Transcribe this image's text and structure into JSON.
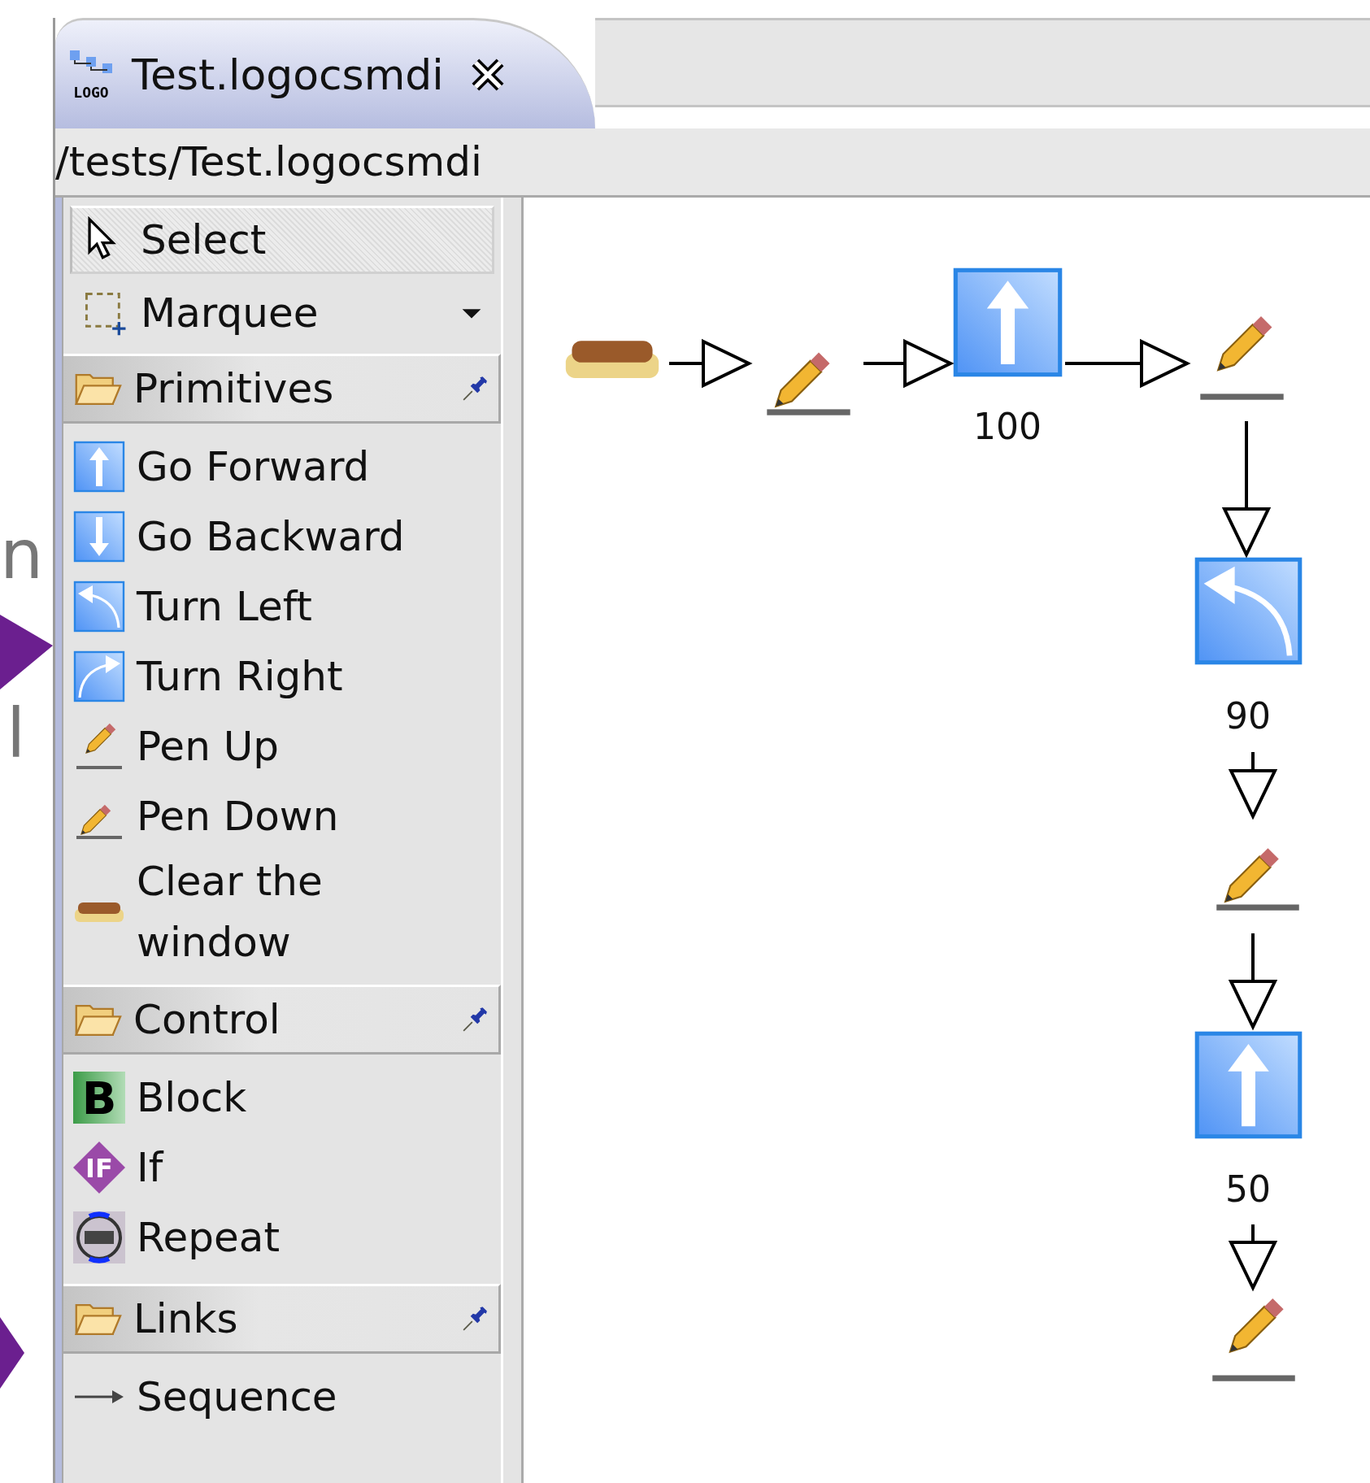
{
  "background": {
    "fragments": [
      "n",
      "l"
    ]
  },
  "editor_tab": {
    "icon_text": "LOGO",
    "title": "Test.logocsmdi"
  },
  "path_bar": {
    "text": "/tests/Test.logocsmdi"
  },
  "palette": {
    "tools": [
      {
        "kind": "select",
        "label": "Select",
        "selected": true
      },
      {
        "kind": "marquee",
        "label": "Marquee",
        "selected": false
      }
    ],
    "drawers": [
      {
        "label": "Primitives",
        "entries": [
          {
            "kind": "forward",
            "label": "Go Forward"
          },
          {
            "kind": "backward",
            "label": "Go Backward"
          },
          {
            "kind": "turn_left",
            "label": "Turn Left"
          },
          {
            "kind": "turn_right",
            "label": "Turn Right"
          },
          {
            "kind": "pen_up",
            "label": "Pen Up"
          },
          {
            "kind": "pen_down",
            "label": "Pen Down"
          },
          {
            "kind": "clear",
            "label": "Clear the window"
          }
        ]
      },
      {
        "label": "Control",
        "entries": [
          {
            "kind": "block",
            "label": "Block",
            "icon_text": "B"
          },
          {
            "kind": "if",
            "label": "If",
            "icon_text": "IF"
          },
          {
            "kind": "repeat",
            "label": "Repeat"
          }
        ]
      },
      {
        "label": "Links",
        "entries": [
          {
            "kind": "sequence",
            "label": "Sequence"
          }
        ]
      }
    ]
  },
  "diagram": {
    "nodes": [
      {
        "kind": "clear"
      },
      {
        "kind": "pen_down"
      },
      {
        "kind": "forward",
        "label": "100"
      },
      {
        "kind": "pen_up"
      },
      {
        "kind": "turn_left",
        "label": "90"
      },
      {
        "kind": "pen_down"
      },
      {
        "kind": "forward",
        "label": "50"
      },
      {
        "kind": "pen_up"
      }
    ]
  }
}
